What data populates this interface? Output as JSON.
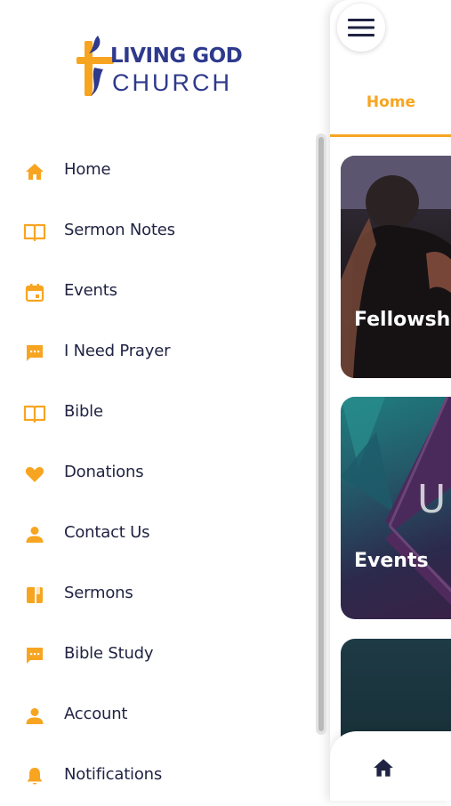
{
  "brand": {
    "name_line1": "LIVING GOD",
    "name_line2": "CHURCH",
    "primary_color": "#2e3a8c",
    "accent_color": "#f7a521"
  },
  "drawer": {
    "items": [
      {
        "label": "Home",
        "icon": "home-icon"
      },
      {
        "label": "Sermon Notes",
        "icon": "book-open-icon"
      },
      {
        "label": "Events",
        "icon": "calendar-icon"
      },
      {
        "label": "I Need Prayer",
        "icon": "chat-icon"
      },
      {
        "label": "Bible",
        "icon": "book-open-icon"
      },
      {
        "label": "Donations",
        "icon": "heart-icon"
      },
      {
        "label": "Contact Us",
        "icon": "person-icon"
      },
      {
        "label": "Sermons",
        "icon": "book-icon"
      },
      {
        "label": "Bible Study",
        "icon": "chat-icon"
      },
      {
        "label": "Account",
        "icon": "person-icon"
      },
      {
        "label": "Notifications",
        "icon": "bell-icon"
      }
    ]
  },
  "main": {
    "active_tab": "Home",
    "cards": [
      {
        "title": "Fellowsh"
      },
      {
        "title": "Events"
      },
      {
        "title": ""
      }
    ],
    "bottom_nav": {
      "active_icon": "home-icon"
    }
  }
}
